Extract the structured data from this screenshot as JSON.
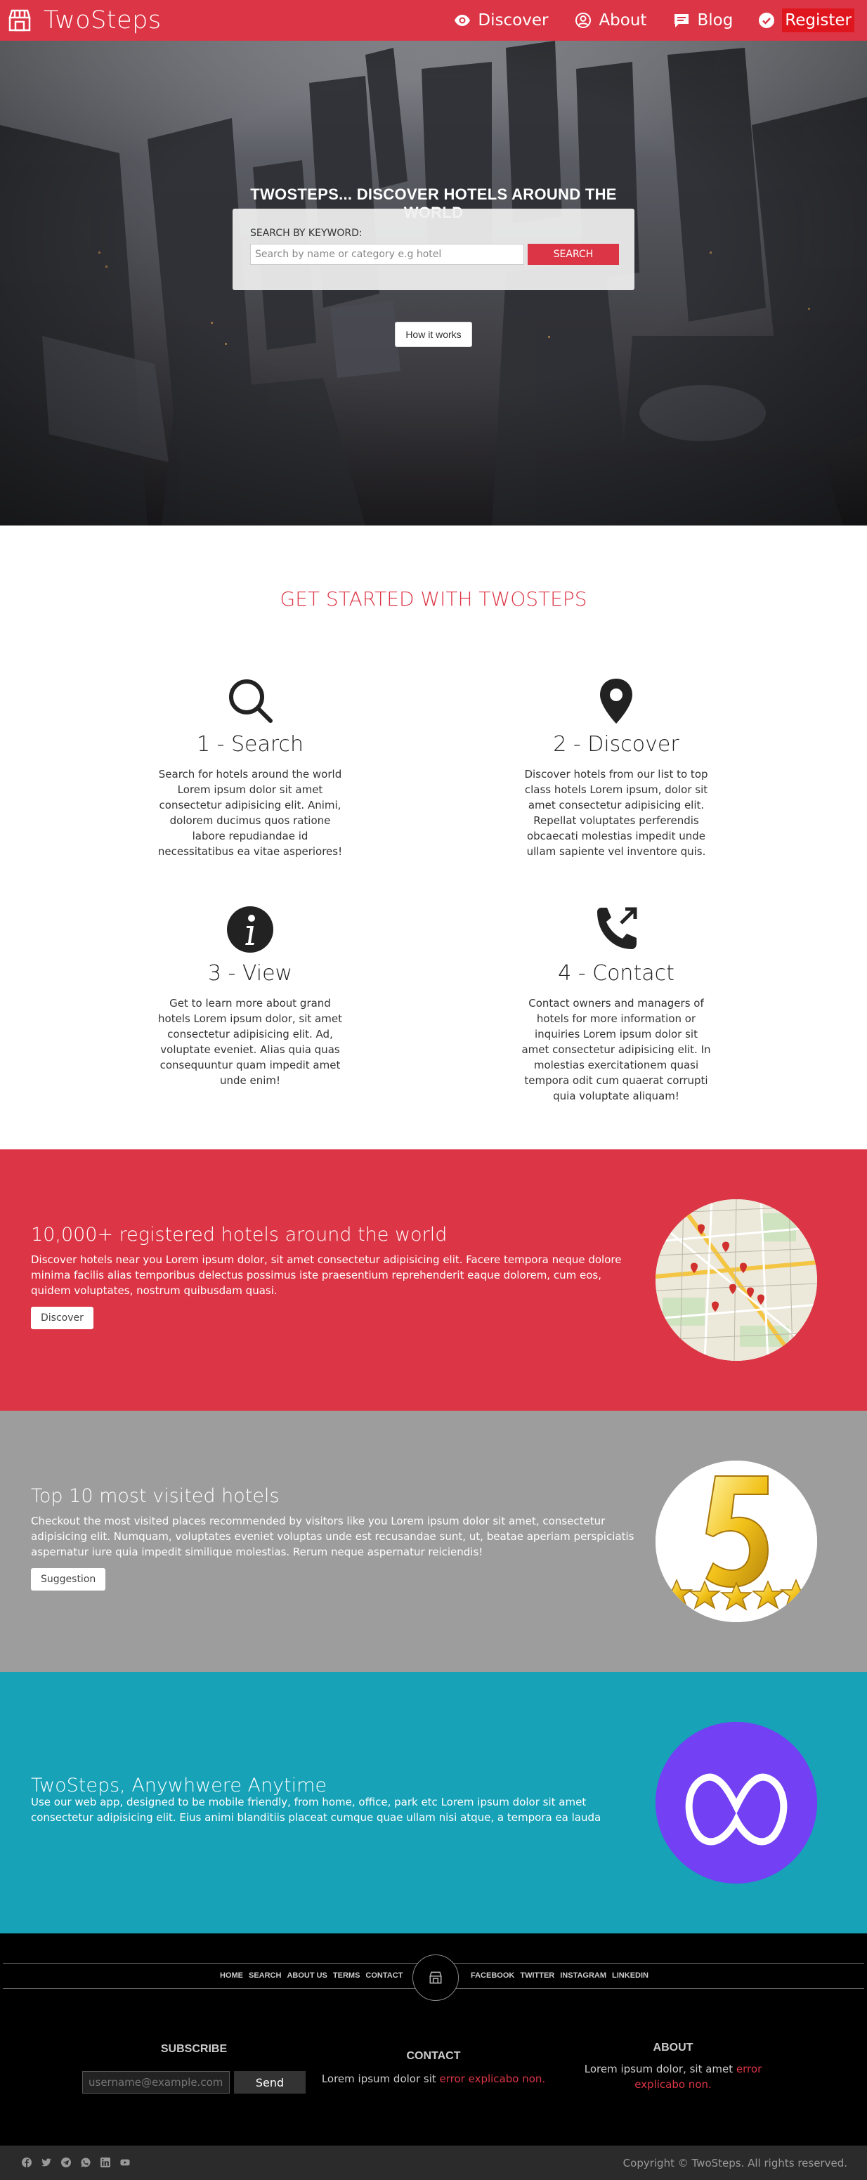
{
  "nav": {
    "brand": "TwoSteps",
    "links": [
      {
        "label": "Discover",
        "icon": "eye-icon"
      },
      {
        "label": "About",
        "icon": "user-circle-icon"
      },
      {
        "label": "Blog",
        "icon": "comment-icon"
      },
      {
        "label": "Register",
        "icon": "check-circle-icon"
      }
    ]
  },
  "hero": {
    "title": "TWOSTEPS... DISCOVER HOTELS AROUND THE WORLD",
    "search_label": "SEARCH BY KEYWORD:",
    "search_placeholder": "Search by name or category e.g hotel",
    "search_button": "SEARCH",
    "how_button": "How it works"
  },
  "started": {
    "title": "GET STARTED WITH TWOSTEPS",
    "steps": [
      {
        "title": "1 - Search",
        "icon": "search-icon",
        "text": "Search for hotels around the world Lorem ipsum dolor sit amet consectetur adipisicing elit. Animi, dolorem ducimus quos ratione labore repudiandae id necessitatibus ea vitae asperiores!"
      },
      {
        "title": "2 - Discover",
        "icon": "map-marker-icon",
        "text": "Discover hotels from our list to top class hotels Lorem ipsum, dolor sit amet consectetur adipisicing elit. Repellat voluptates perferendis obcaecati molestias impedit unde ullam sapiente vel inventore quis."
      },
      {
        "title": "3 - View",
        "icon": "info-circle-icon",
        "text": "Get to learn more about grand hotels Lorem ipsum dolor, sit amet consectetur adipisicing elit. Ad, voluptate eveniet. Alias quia quas consequuntur quam impedit amet unde enim!"
      },
      {
        "title": "4 - Contact",
        "icon": "phone-outgoing-icon",
        "text": "Contact owners and managers of hotels for more information or inquiries Lorem ipsum dolor sit amet consectetur adipisicing elit. In molestias exercitationem quasi tempora odit cum quaerat corrupti quia voluptate aliquam!"
      }
    ]
  },
  "bands": [
    {
      "title": "10,000+ registered hotels around the world",
      "text": "Discover hotels near you Lorem ipsum dolor, sit amet consectetur adipisicing elit. Facere tempora neque dolore minima facilis alias temporibus delectus possimus iste praesentium reprehenderit eaque dolorem, cum eos, quidem voluptates, nostrum quibusdam quasi.",
      "button": "Discover",
      "image": "map-image"
    },
    {
      "title": "Top 10 most visited hotels",
      "text": "Checkout the most visited places recommended by visitors like you Lorem ipsum dolor sit amet, consectetur adipisicing elit. Numquam, voluptates eveniet voluptas unde est recusandae sunt, ut, beatae aperiam perspiciatis aspernatur iure quia impedit similique molestias. Rerum neque aspernatur reiciendis!",
      "button": "Suggestion",
      "image": "five-stars-image"
    },
    {
      "title": "TwoSteps, Anywhwere Anytime",
      "text": "Use our web app, designed to be mobile friendly, from home, office, park etc Lorem ipsum dolor sit amet consectetur adipisicing elit. Eius animi blanditiis placeat cumque quae ullam nisi atque, a tempora ea lauda",
      "button": "",
      "image": "app-logo-image"
    }
  ],
  "footer": {
    "nav_left": [
      "HOME",
      "SEARCH",
      "ABOUT US",
      "TERMS",
      "CONTACT"
    ],
    "nav_right": [
      "FACEBOOK",
      "TWITTER",
      "INSTAGRAM",
      "LINKEDIN"
    ],
    "subscribe_title": "SUBSCRIBE",
    "subscribe_placeholder": "username@example.com",
    "subscribe_button": "Send",
    "contact_title": "CONTACT",
    "contact_text": "Lorem ipsum dolor sit ",
    "contact_red": "error explicabo non.",
    "about_title": "ABOUT",
    "about_text": "Lorem ipsum dolor, sit amet ",
    "about_red": "error explicabo non.",
    "copyright": "Copyright © TwoSteps. All rights reserved.",
    "social_icons": [
      "facebook-icon",
      "twitter-icon",
      "telegram-icon",
      "whatsapp-icon",
      "linkedin-icon",
      "youtube-icon"
    ]
  },
  "colors": {
    "accent": "#dc3545",
    "grey_band": "#9d9d9d",
    "teal_band": "#17a2b8",
    "app_purple": "#7340f4"
  }
}
